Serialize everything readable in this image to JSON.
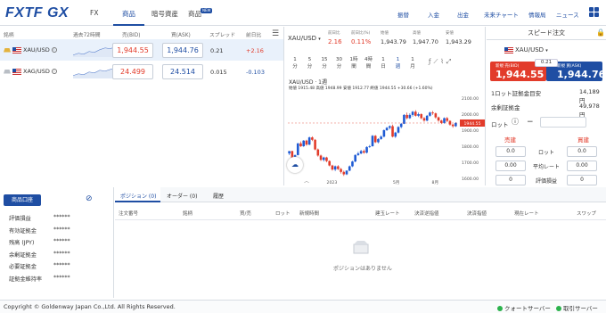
{
  "header": {
    "logo": "FXTF GX",
    "tabs": [
      "FX",
      "商品",
      "暗号資産",
      "商品"
    ],
    "new_badge": "NEW",
    "right_nav": [
      "振替",
      "入金",
      "出金",
      "未来チャート",
      "情報局",
      "ニュース"
    ]
  },
  "quotes": {
    "headers": [
      "銘柄",
      "過去72時間",
      "売(BID)",
      "買(ASK)",
      "スプレッド",
      "前日比"
    ],
    "rows": [
      {
        "symbol": "XAU/USD",
        "bid": "1,944.55",
        "ask": "1,944.76",
        "spread": "0.21",
        "change": "+2.16"
      },
      {
        "symbol": "XAG/USD",
        "bid": "24.499",
        "ask": "24.514",
        "spread": "0.015",
        "change": "-0.103"
      }
    ]
  },
  "chart_panel": {
    "symbol": "XAU/USD",
    "stats": [
      {
        "label": "前日比",
        "value": "2.16"
      },
      {
        "label": "前日比(%)",
        "value": "0.11%"
      },
      {
        "label": "始値",
        "value": "1,943.79"
      },
      {
        "label": "高値",
        "value": "1,947.70"
      },
      {
        "label": "安値",
        "value": "1,943.29"
      }
    ],
    "timeframes": [
      [
        "1",
        "分"
      ],
      [
        "5",
        "分"
      ],
      [
        "15",
        "分"
      ],
      [
        "30",
        "分"
      ],
      [
        "1時",
        "間"
      ],
      [
        "4時",
        "間"
      ],
      [
        "1",
        "日"
      ],
      [
        "1",
        "週"
      ],
      [
        "1",
        "月"
      ]
    ],
    "active_timeframe": 7,
    "legend_title": "XAU/USD · 1週",
    "legend_line": "始値 1915.48  高値 1948.99  安値 1912.77  終値 1944.55  +30.66 (+1.60%)",
    "price_tag": "1944.55"
  },
  "chart_data": {
    "type": "candlestick",
    "title": "XAU/USD · 1週",
    "y_ticks": [
      "2100.00",
      "2000.00",
      "1900.00",
      "1800.00",
      "1700.00",
      "1600.00"
    ],
    "ylim": [
      1600,
      2100
    ],
    "x_ticks": [
      "2023",
      "5月",
      "8月"
    ],
    "last_price": 1944.55,
    "candles": [
      [
        1755,
        1770,
        1745,
        1770
      ],
      [
        1770,
        1725,
        1718,
        1772
      ],
      [
        1725,
        1745,
        1720,
        1748
      ],
      [
        1745,
        1818,
        1743,
        1820
      ],
      [
        1818,
        1800,
        1795,
        1830
      ],
      [
        1800,
        1835,
        1796,
        1838
      ],
      [
        1835,
        1810,
        1803,
        1840
      ],
      [
        1810,
        1855,
        1807,
        1860
      ],
      [
        1855,
        1840,
        1832,
        1862
      ],
      [
        1840,
        1780,
        1775,
        1845
      ],
      [
        1780,
        1742,
        1735,
        1786
      ],
      [
        1742,
        1715,
        1708,
        1748
      ],
      [
        1715,
        1730,
        1705,
        1735
      ],
      [
        1730,
        1708,
        1700,
        1735
      ],
      [
        1708,
        1680,
        1675,
        1712
      ],
      [
        1680,
        1655,
        1648,
        1685
      ],
      [
        1655,
        1675,
        1645,
        1680
      ],
      [
        1675,
        1658,
        1652,
        1682
      ],
      [
        1658,
        1640,
        1630,
        1665
      ],
      [
        1640,
        1625,
        1615,
        1648
      ],
      [
        1625,
        1648,
        1620,
        1650
      ],
      [
        1648,
        1675,
        1645,
        1680
      ],
      [
        1675,
        1705,
        1670,
        1710
      ],
      [
        1705,
        1745,
        1700,
        1750
      ],
      [
        1745,
        1755,
        1740,
        1765
      ],
      [
        1755,
        1770,
        1750,
        1778
      ],
      [
        1770,
        1760,
        1753,
        1780
      ],
      [
        1760,
        1795,
        1755,
        1800
      ],
      [
        1795,
        1800,
        1790,
        1808
      ],
      [
        1800,
        1865,
        1798,
        1870
      ],
      [
        1865,
        1825,
        1820,
        1870
      ],
      [
        1825,
        1845,
        1818,
        1850
      ],
      [
        1845,
        1860,
        1840,
        1868
      ],
      [
        1860,
        1900,
        1855,
        1905
      ],
      [
        1900,
        1915,
        1895,
        1920
      ],
      [
        1915,
        1925,
        1905,
        1930
      ],
      [
        1925,
        1860,
        1855,
        1935
      ],
      [
        1860,
        1885,
        1852,
        1890
      ],
      [
        1885,
        1920,
        1880,
        1925
      ],
      [
        1920,
        1940,
        1912,
        1945
      ],
      [
        1940,
        1995,
        1938,
        2000
      ],
      [
        1995,
        1975,
        1968,
        2010
      ],
      [
        1975,
        1995,
        1970,
        2005
      ],
      [
        1995,
        2015,
        1985,
        2020
      ],
      [
        2015,
        1990,
        1985,
        2025
      ],
      [
        1990,
        2000,
        1982,
        2010
      ],
      [
        2000,
        1975,
        1968,
        2005
      ],
      [
        1975,
        1960,
        1952,
        1982
      ],
      [
        1960,
        1990,
        1955,
        1995
      ],
      [
        1990,
        2010,
        1985,
        2015
      ],
      [
        2010,
        2005,
        1995,
        2020
      ],
      [
        2005,
        1980,
        1972,
        2010
      ],
      [
        1980,
        1960,
        1952,
        1985
      ],
      [
        1960,
        1945,
        1938,
        1965
      ],
      [
        1945,
        1975,
        1940,
        1980
      ],
      [
        1975,
        1958,
        1950,
        1982
      ],
      [
        1958,
        1935,
        1928,
        1962
      ],
      [
        1935,
        1925,
        1915,
        1940
      ],
      [
        1925,
        1945,
        1920,
        1950
      ]
    ]
  },
  "speed_order": {
    "title": "スピード注文",
    "symbol": "XAU/USD",
    "spread": "0.21",
    "sell_label": "新規 売(BID)",
    "buy_label": "新規 買(ASK)",
    "bid": "1,944.55",
    "ask": "1,944.76",
    "margin_label": "1ロット証拠金目安",
    "margin_value": "14,189 円",
    "remaining_label": "余剰証拠金",
    "remaining_value": "49,978 円",
    "lot_label": "ロット",
    "minus": "−",
    "sell_header": "売建",
    "buy_header": "買建",
    "rows": [
      {
        "left": "0.0",
        "label": "ロット",
        "right": "0.0"
      },
      {
        "left": "0.00",
        "label": "平均レート",
        "right": "0.00"
      },
      {
        "left": "0",
        "label": "評価損益",
        "right": "0"
      }
    ]
  },
  "account": {
    "button": "商品口座",
    "items": [
      {
        "label": "評価損益",
        "value": "******"
      },
      {
        "label": "有効証拠金",
        "value": "******"
      },
      {
        "label": "残高 (JPY)",
        "value": "******"
      },
      {
        "label": "余剰証拠金",
        "value": "******"
      },
      {
        "label": "必要証拠金",
        "value": "******"
      },
      {
        "label": "証拠金維持率",
        "value": "******"
      }
    ]
  },
  "positions": {
    "tabs": [
      "ポジション (0)",
      "オーダー (0)",
      "履歴"
    ],
    "columns": [
      "注文番号",
      "銘柄",
      "買/売",
      "ロット",
      "新規時間",
      "建玉レート",
      "決済逆指値",
      "決済指値",
      "現在レート",
      "スワップ"
    ],
    "empty": "ポジションはありません"
  },
  "footer": {
    "copyright": "Copyright © Goldenway Japan Co.,Ltd. All Rights Reserved.",
    "quote_server": "クォートサーバー",
    "trade_server": "取引サーバー"
  }
}
